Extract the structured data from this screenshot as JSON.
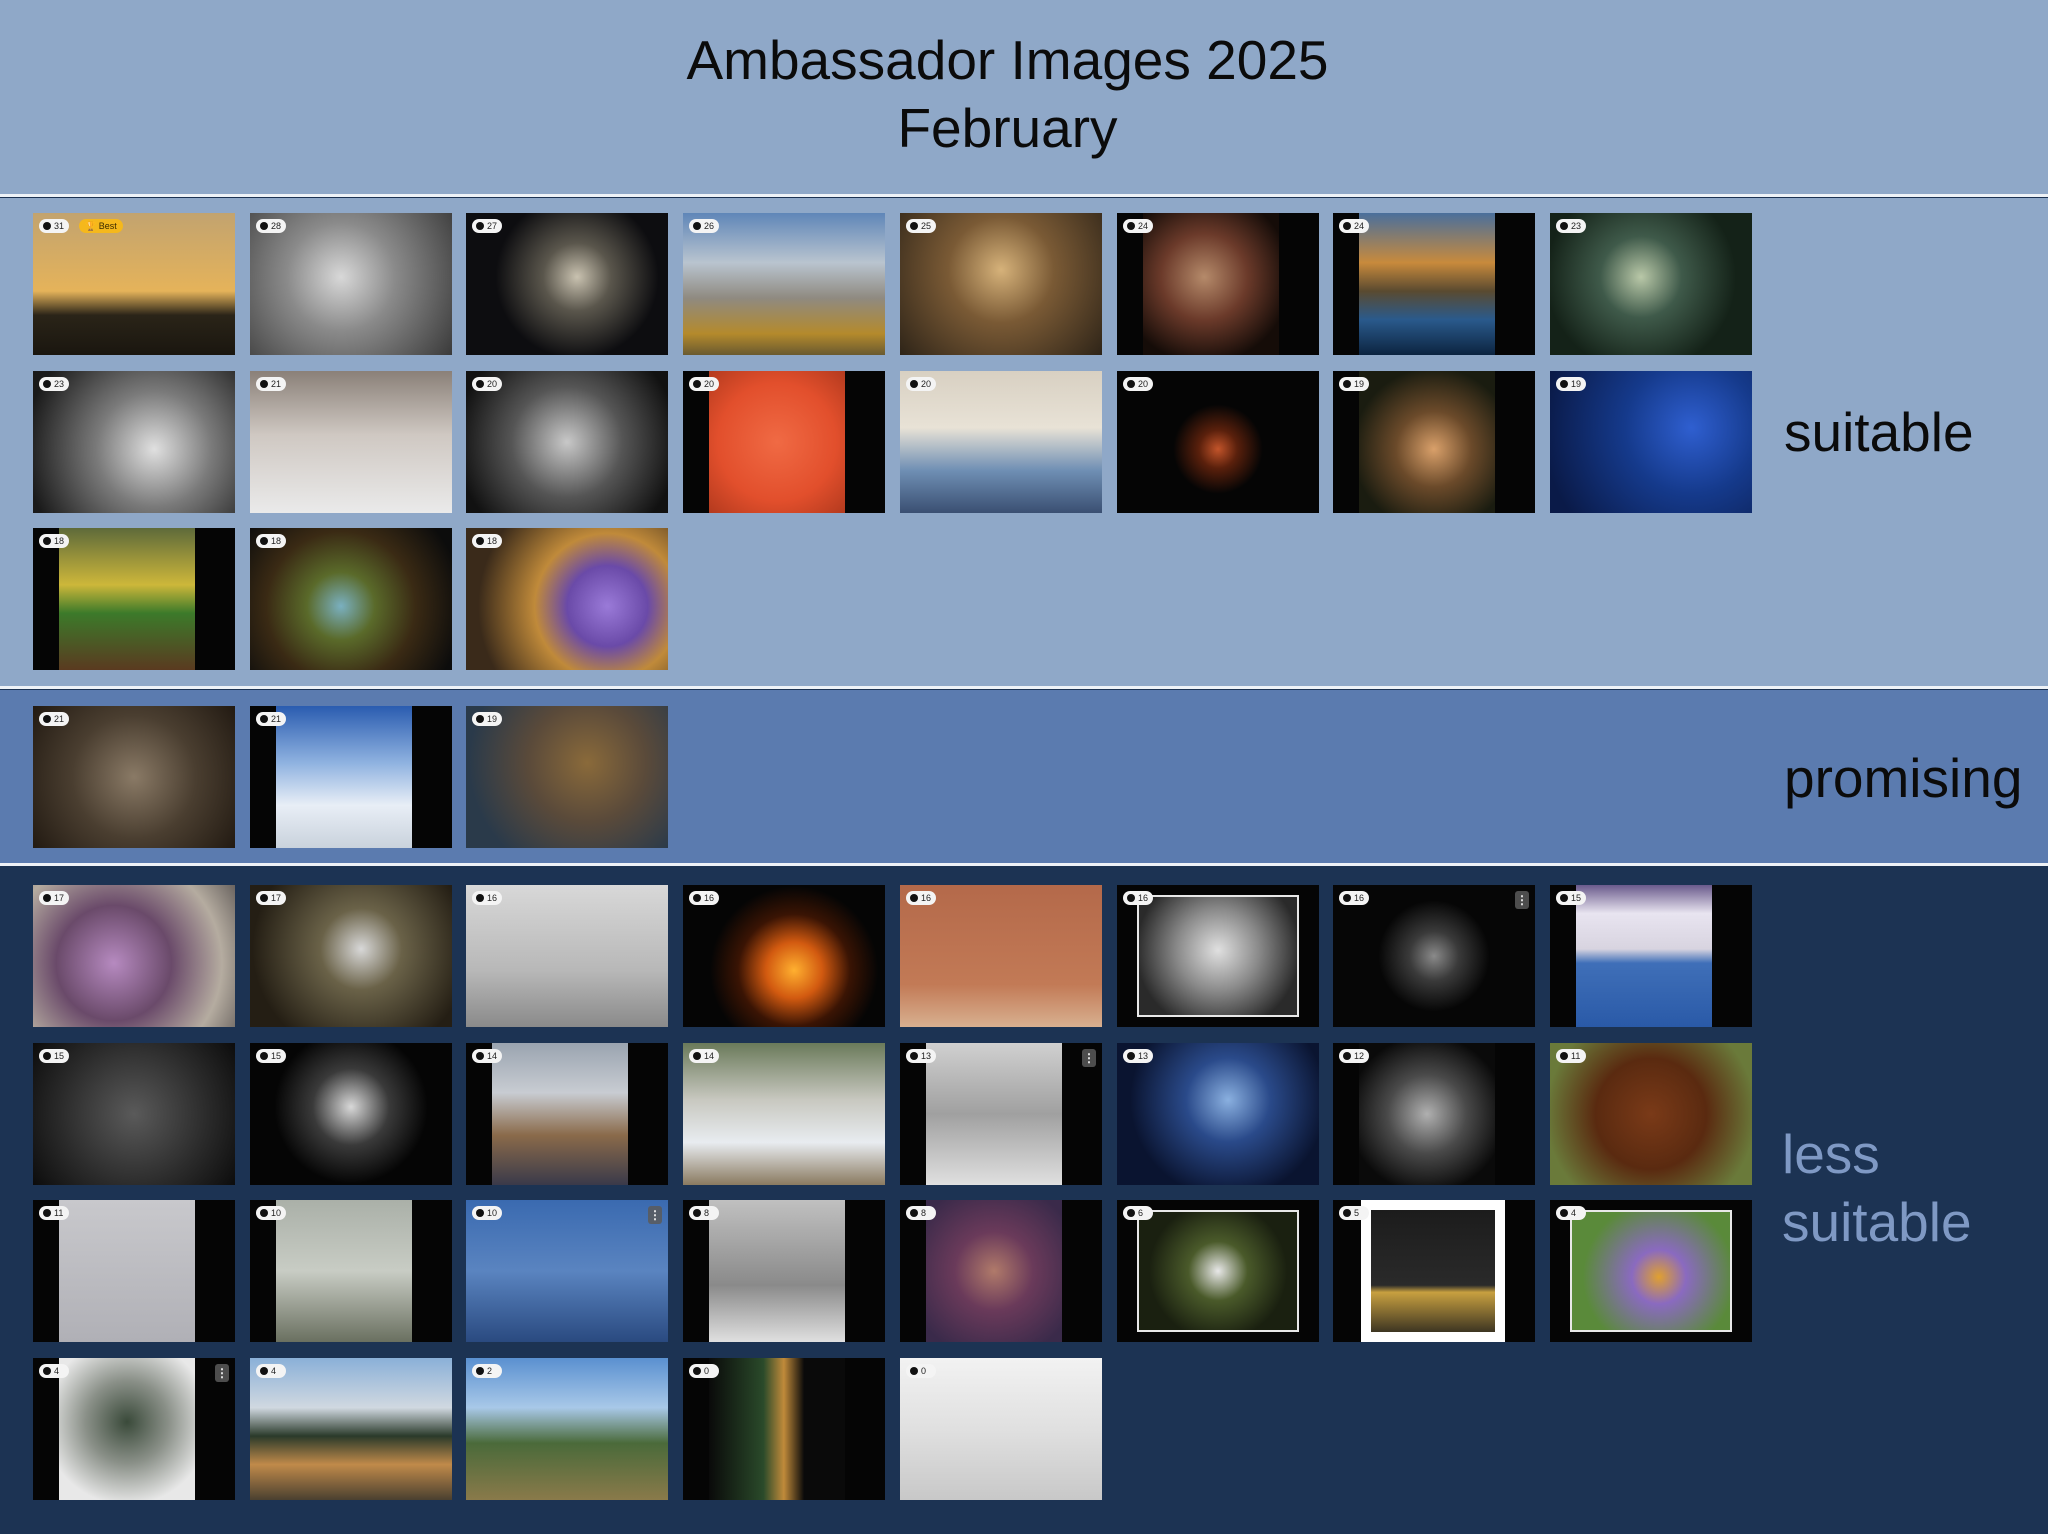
{
  "title": "Ambassador Images 2025",
  "subtitle": "February",
  "sections": {
    "suitable": {
      "label": "suitable",
      "items": [
        {
          "score": "31",
          "badge": "Best",
          "bg": "linear-gradient(180deg,#c2a36f 0%,#e5b35a 55%,#2a2418 72%,#1a160f 100%)",
          "icon": "sunset-runner"
        },
        {
          "score": "28",
          "bg": "radial-gradient(circle at 45% 45%,#d8d8d8 0%,#8a8a8a 40%,#3a3a3a 100%)",
          "icon": "child-portrait"
        },
        {
          "score": "27",
          "bg": "radial-gradient(circle at 55% 45%,#c9c2b0 0%,#5a564c 25%,#0d0d10 60%)",
          "icon": "dried-flowers"
        },
        {
          "score": "26",
          "bg": "linear-gradient(180deg,#5f86b8 0%,#b9c4cf 35%,#8f8a80 60%,#b48a2c 85%,#6a5a30 100%)",
          "icon": "mountains"
        },
        {
          "score": "25",
          "bg": "radial-gradient(circle at 50% 40%,#d6b27a 0%,#7a5a35 40%,#2e2418 100%)",
          "icon": "arcade"
        },
        {
          "score": "24",
          "bg": "radial-gradient(circle at 45% 45%,#b58a6a 0%,#6b3a2a 40%,#150c08 80%)",
          "icon": "girl-costume",
          "pad": "x"
        },
        {
          "score": "24",
          "bg": "linear-gradient(180deg,#4a6f9c 0%,#c88a3c 35%,#5a4a30 55%,#2a5a8c 75%,#0c2440 100%)",
          "icon": "lake-boats",
          "pad": "x"
        },
        {
          "score": "23",
          "bg": "radial-gradient(circle at 45% 45%,#b9c8a8 0%,#3f5a4a 30%,#142218 70%)",
          "icon": "glass-rose"
        },
        {
          "score": "23",
          "bg": "radial-gradient(circle at 60% 55%,#e0e0e0 0%,#7a7a7a 40%,#1a1a1a 90%)",
          "icon": "laughing-child"
        },
        {
          "score": "21",
          "bg": "linear-gradient(180deg,#8a8078 0%,#cfc8c2 45%,#eaeaea 100%)",
          "icon": "dog-snow"
        },
        {
          "score": "20",
          "bg": "radial-gradient(circle at 50% 50%,#c8c8c8 0%,#555 45%,#111 90%)",
          "icon": "couple"
        },
        {
          "score": "20",
          "bg": "radial-gradient(circle at 50% 50%,#f06a44 0%,#e24f2c 60%,#b33a1e 100%)",
          "icon": "candy-spoons",
          "pad": "x"
        },
        {
          "score": "20",
          "bg": "linear-gradient(180deg,#d8d0c2 0%,#e8e2d6 40%,#6f8fb4 70%,#3a4f72 100%)",
          "icon": "canal"
        },
        {
          "score": "20",
          "bg": "radial-gradient(circle at 50% 55%,#c2542a 0%,#5a200c 15%,#050505 35%)",
          "icon": "tulips"
        },
        {
          "score": "19",
          "bg": "radial-gradient(circle at 55% 55%,#d9a06a 0%,#6b4a2a 35%,#1a1c10 75%)",
          "icon": "fox",
          "pad": "x"
        },
        {
          "score": "19",
          "bg": "radial-gradient(circle at 70% 40%,#2f5fd0 0%,#153a8c 40%,#0a1a48 90%)",
          "icon": "performer"
        },
        {
          "score": "18",
          "bg": "linear-gradient(180deg,#5e6a3a 0%,#cdb73a 40%,#3c7a2a 60%,#5a3a20 100%)",
          "icon": "lovebirds",
          "pad": "x"
        },
        {
          "score": "18",
          "bg": "radial-gradient(circle at 45% 55%,#7ab0c0 0%,#5a6a2a 25%,#3a2a14 55%,#0c0c0c 90%)",
          "icon": "nebula"
        },
        {
          "score": "18",
          "bg": "radial-gradient(circle at 70% 55%,#9a7ad8 0%,#6a4aa8 25%,#c08a3a 45%,#3a2a1a 80%)",
          "icon": "bee-crocus"
        }
      ]
    },
    "promising": {
      "label": "promising",
      "items": [
        {
          "score": "21",
          "bg": "radial-gradient(circle at 50% 50%,#8a7a66 0%,#4a3e30 50%,#221a12 100%)",
          "icon": "deer-room"
        },
        {
          "score": "21",
          "bg": "linear-gradient(180deg,#2a5cb0 0%,#8fb2e0 40%,#e8eef6 70%,#c9d2dc 100%)",
          "icon": "ice-tree",
          "pad": "x"
        },
        {
          "score": "19",
          "bg": "radial-gradient(circle at 60% 40%,#8a6a3a 0%,#5a4a3a 40%,#2a3a4a 80%)",
          "icon": "fishing-nets"
        }
      ]
    },
    "less": {
      "label": "less\nsuitable",
      "items": [
        {
          "score": "17",
          "bg": "radial-gradient(circle at 40% 55%,#b68ac0 0%,#6a4a6a 40%,#b5aca0 75%,#6a6460 100%)",
          "icon": "girl-pigeons"
        },
        {
          "score": "17",
          "bg": "radial-gradient(circle at 55% 45%,#d8d8d8 0%,#6a6248 30%,#241e14 80%)",
          "icon": "snow-splash"
        },
        {
          "score": "16",
          "bg": "linear-gradient(180deg,#d8d8d8 0%,#b8b8b8 60%,#8a8a8a 100%)",
          "icon": "graffiti-kids"
        },
        {
          "score": "16",
          "bg": "radial-gradient(circle at 55% 60%,#ffb030 0%,#d25a10 20%,#3a1404 40%,#050505 60%)",
          "icon": "fire"
        },
        {
          "score": "16",
          "bg": "linear-gradient(180deg,#b4694a 0%,#c27a56 70%,#d8b090 100%)",
          "icon": "orange-wall"
        },
        {
          "score": "16",
          "bg": "radial-gradient(circle at 50% 45%,#e0e0e0 0%,#8a8a8a 40%,#2a2a2a 80%)",
          "icon": "old-man",
          "pad": "frame"
        },
        {
          "score": "16",
          "bg": "radial-gradient(circle at 50% 50%,#8a8a8a 0%,#3a3a3a 20%,#060606 45%)",
          "icon": "pineapple",
          "menu": true
        },
        {
          "score": "15",
          "bg": "linear-gradient(180deg,#6a5a8c 0%,#e8e4f0 20%,#d8d4e0 45%,#3f6fb8 55%,#2a5aa8 100%)",
          "icon": "french-shop",
          "pad": "x"
        },
        {
          "score": "15",
          "bg": "radial-gradient(circle at 50% 50%,#5a5a5a 0%,#2a2a2a 60%,#0c0c0c 100%)",
          "icon": "door-knockers"
        },
        {
          "score": "15",
          "bg": "radial-gradient(circle at 50% 45%,#d8d8d8 0%,#3a3a3a 30%,#050505 60%)",
          "icon": "skater"
        },
        {
          "score": "14",
          "bg": "linear-gradient(180deg,#9aa4b0 0%,#c8ccd2 35%,#8a6a4a 65%,#3a3a4a 100%)",
          "icon": "market-street",
          "pad": "x"
        },
        {
          "score": "14",
          "bg": "linear-gradient(180deg,#6a7a5a 0%,#c8c8c0 40%,#e8ecf0 70%,#8a7a60 100%)",
          "icon": "waterfall"
        },
        {
          "score": "13",
          "bg": "linear-gradient(180deg,#d0d0d0 0%,#a0a0a0 50%,#e0e0e0 100%)",
          "icon": "street-couple",
          "pad": "x",
          "menu": true
        },
        {
          "score": "13",
          "bg": "radial-gradient(circle at 55% 40%,#8ab0e0 0%,#2a4a8a 30%,#0a1430 70%)",
          "icon": "open-book"
        },
        {
          "score": "12",
          "bg": "radial-gradient(circle at 50% 50%,#b0b0b0 0%,#4a4a4a 40%,#0a0a0a 80%)",
          "icon": "guitarist",
          "pad": "x"
        },
        {
          "score": "11",
          "bg": "radial-gradient(circle at 50% 50%,#7a3a18 0%,#5a2a10 45%,#6a7a3a 85%)",
          "icon": "orangutan"
        },
        {
          "score": "11",
          "bg": "linear-gradient(180deg,#c8c8cc 0%,#b0b0b6 100%)",
          "icon": "swan-child",
          "pad": "x"
        },
        {
          "score": "10",
          "bg": "linear-gradient(180deg,#aab0a8 0%,#c8ccc4 50%,#6a7060 100%)",
          "icon": "winter-reeds",
          "pad": "x"
        },
        {
          "score": "10",
          "bg": "linear-gradient(180deg,#3a6ab0 0%,#5a84c0 50%,#2a4a80 100%)",
          "icon": "flamingos",
          "menu": true
        },
        {
          "score": "8",
          "bg": "linear-gradient(180deg,#c0c0c0 0%,#8a8a8a 60%,#e0e0e0 100%)",
          "icon": "chairs",
          "pad": "x"
        },
        {
          "score": "8",
          "bg": "radial-gradient(circle at 50% 50%,#b07a6a 0%,#6a3a5a 40%,#3a2a4a 90%)",
          "icon": "abstract-collage",
          "pad": "x"
        },
        {
          "score": "6",
          "bg": "radial-gradient(circle at 50% 50%,#e8e8e8 0%,#4a5a2a 30%,#1a2010 70%)",
          "icon": "snowdrop",
          "pad": "frame"
        },
        {
          "score": "5",
          "bg": "linear-gradient(180deg,#1a1a1a 0%,#2a2a2a 60%,#c8a040 65%,#1a1a1a 100%)",
          "icon": "gallery-room",
          "pad": "whiteframe"
        },
        {
          "score": "4",
          "bg": "radial-gradient(circle at 55% 55%,#e0a030 0%,#8a6ac0 25%,#5a8a3a 70%)",
          "icon": "bee-crocus-2",
          "pad": "frame"
        },
        {
          "score": "4",
          "bg": "radial-gradient(circle at 50% 45%,#3a4a3a 0%,#8a9088 40%,#e8e8e8 80%)",
          "icon": "snowy-fir",
          "pad": "x",
          "menu": true
        },
        {
          "score": "4",
          "bg": "linear-gradient(180deg,#8ab0d8 0%,#d0d8e0 35%,#2a3a2a 55%,#c08a4a 75%,#4a4030 100%)",
          "icon": "pond-sunset"
        },
        {
          "score": "2",
          "bg": "linear-gradient(180deg,#5a90d0 0%,#a8c8e8 35%,#4a6a3a 60%,#8a7a4a 100%)",
          "icon": "village-valley"
        },
        {
          "score": "0",
          "bg": "linear-gradient(90deg,#0a0a0a 0%,#2a4a2a 40%,#c08a3a 55%,#0a0a0a 70%)",
          "icon": "christmas-decor",
          "pad": "x"
        },
        {
          "score": "0",
          "bg": "linear-gradient(180deg,#f2f2f2 0%,#e0e0e0 50%,#c8c8c8 100%)",
          "icon": "fir-ornament"
        }
      ]
    }
  }
}
